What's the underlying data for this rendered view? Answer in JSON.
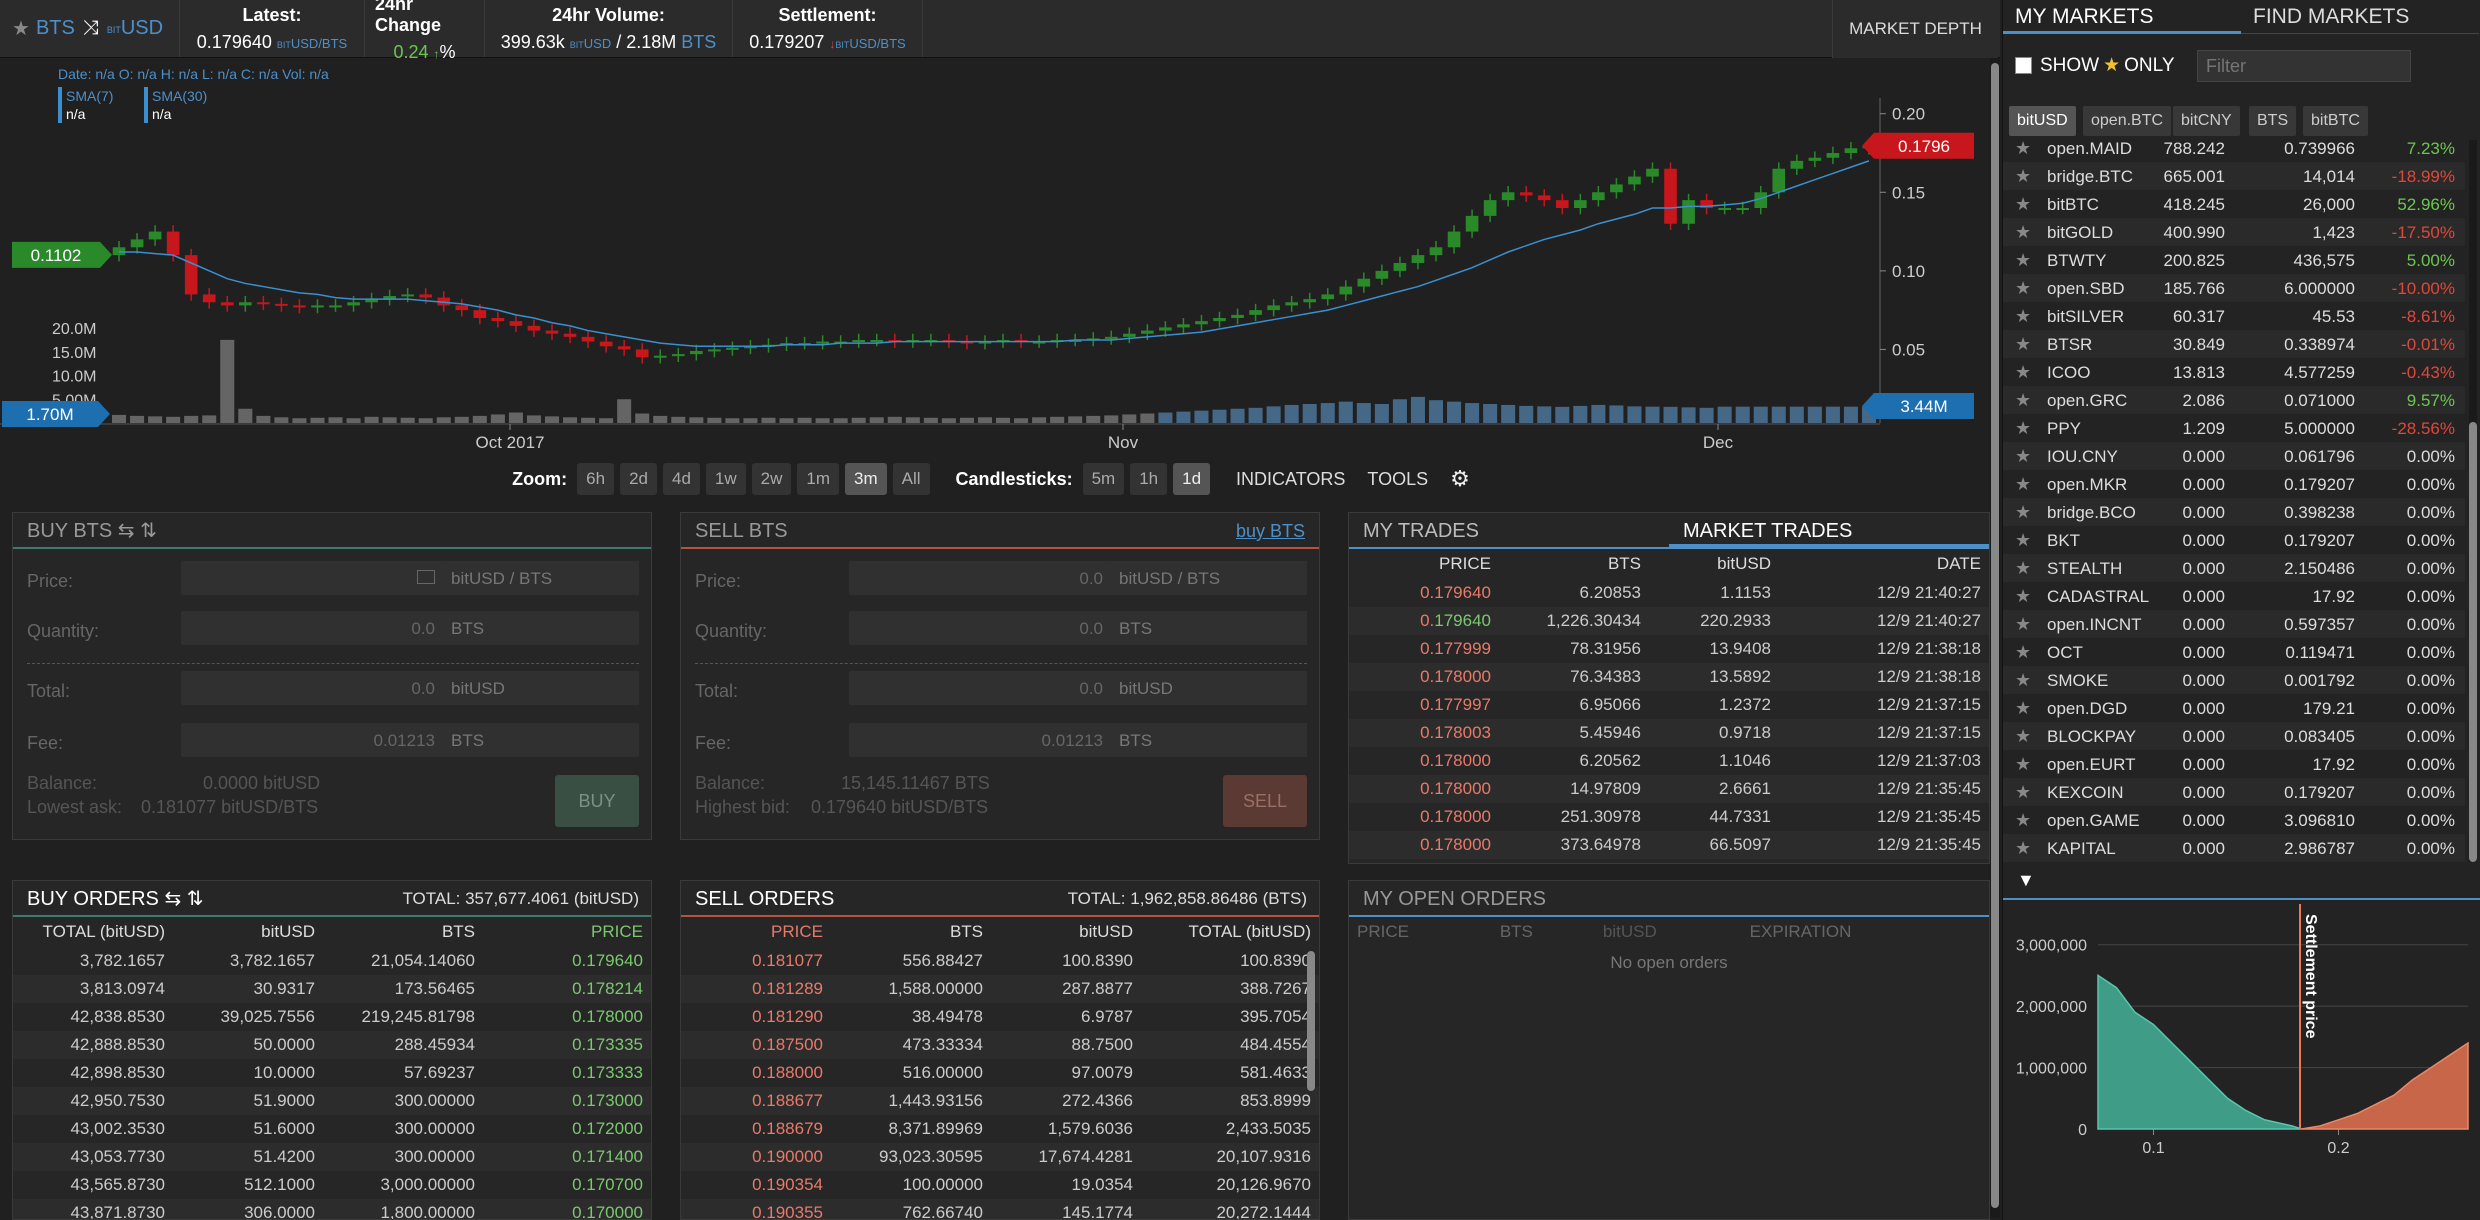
{
  "header": {
    "star": "★",
    "base": "BTS",
    "swap": "⤨",
    "quote_prefix": "bit",
    "quote": "USD",
    "latest_label": "Latest:",
    "latest_value": "0.179640",
    "latest_unit": "bitUSD/BTS",
    "change_label": "24hr Change",
    "change_value": "0.24",
    "change_arrow": "↑",
    "change_unit": "%",
    "volume_label": "24hr Volume:",
    "volume_quote": "399.63k",
    "volume_quote_unit": "bitUSD",
    "volume_base": "/ 2.18M",
    "volume_base_unit": "BTS",
    "settle_label": "Settlement:",
    "settle_value": "0.179207",
    "settle_arrow": "↓",
    "settle_unit": "bitUSD/BTS",
    "market_depth": "MARKET DEPTH"
  },
  "chart_info": {
    "legend": "Date: n/a O: n/a H: n/a L: n/a C: n/a Vol: n/a",
    "sma7_label": "SMA(7)",
    "sma7_val": "n/a",
    "sma30_label": "SMA(30)",
    "sma30_val": "n/a",
    "left_price_badge": "0.1102",
    "right_price_badge": "0.1796",
    "left_vol_badge": "1.70M",
    "right_vol_badge": "3.44M",
    "price_ticks": [
      "0.20",
      "0.15",
      "0.10",
      "0.05"
    ],
    "vol_ticks": [
      "20.0M",
      "15.0M",
      "10.0M",
      "5.00M"
    ],
    "date_ticks": [
      "Oct 2017",
      "Nov",
      "Dec"
    ]
  },
  "chart_data": {
    "type": "candlestick",
    "ylim": [
      0,
      0.21
    ],
    "close": [
      0.115,
      0.12,
      0.125,
      0.11,
      0.085,
      0.08,
      0.078,
      0.08,
      0.079,
      0.078,
      0.077,
      0.078,
      0.078,
      0.08,
      0.082,
      0.084,
      0.085,
      0.083,
      0.078,
      0.075,
      0.07,
      0.068,
      0.065,
      0.062,
      0.06,
      0.058,
      0.055,
      0.052,
      0.05,
      0.045,
      0.046,
      0.047,
      0.049,
      0.05,
      0.051,
      0.052,
      0.053,
      0.054,
      0.054,
      0.055,
      0.055,
      0.056,
      0.056,
      0.055,
      0.056,
      0.056,
      0.055,
      0.054,
      0.055,
      0.056,
      0.055,
      0.055,
      0.056,
      0.056,
      0.057,
      0.058,
      0.06,
      0.062,
      0.064,
      0.066,
      0.068,
      0.07,
      0.072,
      0.075,
      0.078,
      0.08,
      0.082,
      0.085,
      0.09,
      0.095,
      0.1,
      0.105,
      0.11,
      0.115,
      0.125,
      0.135,
      0.145,
      0.15,
      0.148,
      0.145,
      0.14,
      0.145,
      0.15,
      0.155,
      0.16,
      0.165,
      0.13,
      0.145,
      0.14,
      0.14,
      0.14,
      0.15,
      0.165,
      0.17,
      0.172,
      0.175,
      0.178,
      0.18
    ],
    "volume": [
      1.7,
      1.5,
      1.4,
      1.3,
      1.5,
      1.6,
      17.5,
      3.0,
      1.5,
      1.2,
      1.0,
      1.1,
      1.2,
      1.0,
      1.3,
      1.2,
      1.1,
      1.0,
      1.2,
      1.3,
      1.5,
      1.8,
      2.2,
      1.6,
      1.4,
      1.2,
      1.1,
      1.0,
      5.0,
      2.0,
      1.5,
      1.3,
      1.2,
      1.1,
      1.0,
      1.0,
      1.1,
      1.0,
      1.1,
      1.0,
      1.0,
      1.1,
      1.2,
      1.3,
      1.2,
      1.1,
      1.0,
      1.1,
      1.2,
      1.1,
      1.0,
      1.2,
      1.3,
      1.4,
      1.5,
      1.6,
      1.8,
      2.0,
      2.2,
      2.4,
      2.6,
      2.8,
      3.0,
      3.2,
      3.5,
      3.8,
      4.0,
      4.2,
      4.5,
      4.2,
      4.0,
      5.0,
      5.5,
      4.8,
      4.5,
      4.2,
      4.0,
      3.8,
      3.6,
      3.5,
      3.4,
      3.6,
      3.8,
      3.7,
      3.5,
      3.44,
      3.4,
      3.3,
      3.2,
      3.44,
      3.44,
      3.44,
      3.44,
      3.44,
      3.44,
      3.44,
      3.44,
      3.44
    ],
    "sma": [
      0.112,
      0.112,
      0.111,
      0.11,
      0.105,
      0.1,
      0.095,
      0.092,
      0.09,
      0.088,
      0.086,
      0.085,
      0.083,
      0.082,
      0.082,
      0.082,
      0.082,
      0.081,
      0.08,
      0.079,
      0.077,
      0.075,
      0.072,
      0.07,
      0.067,
      0.065,
      0.062,
      0.06,
      0.058,
      0.056,
      0.054,
      0.053,
      0.052,
      0.052,
      0.052,
      0.052,
      0.052,
      0.053,
      0.053,
      0.053,
      0.054,
      0.054,
      0.054,
      0.055,
      0.055,
      0.055,
      0.055,
      0.055,
      0.055,
      0.055,
      0.055,
      0.055,
      0.055,
      0.056,
      0.056,
      0.056,
      0.057,
      0.058,
      0.059,
      0.06,
      0.061,
      0.063,
      0.065,
      0.067,
      0.069,
      0.071,
      0.073,
      0.075,
      0.078,
      0.081,
      0.084,
      0.087,
      0.09,
      0.094,
      0.098,
      0.102,
      0.107,
      0.112,
      0.116,
      0.12,
      0.123,
      0.126,
      0.13,
      0.133,
      0.136,
      0.14,
      0.14,
      0.141,
      0.141,
      0.142,
      0.143,
      0.146,
      0.15,
      0.154,
      0.158,
      0.162,
      0.166,
      0.17
    ]
  },
  "zoom": {
    "label": "Zoom:",
    "options": [
      "6h",
      "2d",
      "4d",
      "1w",
      "2w",
      "1m",
      "3m",
      "All"
    ],
    "candle_label": "Candlesticks:",
    "candle_options": [
      "5m",
      "1h",
      "1d"
    ],
    "indicators": "INDICATORS",
    "tools": "TOOLS",
    "gear": "⚙"
  },
  "buy_form": {
    "title": "BUY BTS ⇆ ⇅",
    "price_label": "Price:",
    "price_unit": "bitUSD / BTS",
    "qty_label": "Quantity:",
    "qty_value": "0.0",
    "qty_unit": "BTS",
    "total_label": "Total:",
    "total_value": "0.0",
    "total_unit": "bitUSD",
    "fee_label": "Fee:",
    "fee_value": "0.01213",
    "fee_unit": "BTS",
    "balance_label": "Balance:",
    "balance_value": "0.0000 bitUSD",
    "ask_label": "Lowest ask:",
    "ask_value": "0.181077 bitUSD/BTS",
    "button": "BUY"
  },
  "sell_form": {
    "title": "SELL BTS",
    "link": "buy BTS",
    "price_label": "Price:",
    "price_value": "0.0",
    "price_unit": "bitUSD / BTS",
    "qty_label": "Quantity:",
    "qty_value": "0.0",
    "qty_unit": "BTS",
    "total_label": "Total:",
    "total_value": "0.0",
    "total_unit": "bitUSD",
    "fee_label": "Fee:",
    "fee_value": "0.01213",
    "fee_unit": "BTS",
    "balance_label": "Balance:",
    "balance_value": "15,145.11467 BTS",
    "bid_label": "Highest bid:",
    "bid_value": "0.179640 bitUSD/BTS",
    "button": "SELL"
  },
  "trades": {
    "tab_mine": "MY TRADES",
    "tab_market": "MARKET TRADES",
    "headers": [
      "PRICE",
      "BTS",
      "bitUSD",
      "DATE"
    ],
    "rows": [
      [
        "0.",
        "179640",
        "6.20853",
        "1.1153",
        "12/9 21:40:27",
        "red"
      ],
      [
        "0.",
        "179640",
        "1,226.30434",
        "220.2933",
        "12/9 21:40:27",
        "green"
      ],
      [
        "0.",
        "177999",
        "78.31956",
        "13.9408",
        "12/9 21:38:18",
        "red"
      ],
      [
        "0.",
        "178000",
        "76.34383",
        "13.5892",
        "12/9 21:38:18",
        "red"
      ],
      [
        "0.",
        "177997",
        "6.95066",
        "1.2372",
        "12/9 21:37:15",
        "red"
      ],
      [
        "0.",
        "178003",
        "5.45946",
        "0.9718",
        "12/9 21:37:15",
        "red"
      ],
      [
        "0.",
        "178000",
        "6.20562",
        "1.1046",
        "12/9 21:37:03",
        "red"
      ],
      [
        "0.",
        "178000",
        "14.97809",
        "2.6661",
        "12/9 21:35:45",
        "red"
      ],
      [
        "0.",
        "178000",
        "251.30978",
        "44.7331",
        "12/9 21:35:45",
        "red"
      ],
      [
        "0.",
        "178000",
        "373.64978",
        "66.5097",
        "12/9 21:35:45",
        "red"
      ]
    ]
  },
  "buy_orders": {
    "title": "BUY ORDERS ⇆ ⇅",
    "total": "TOTAL: 357,677.4061 (bitUSD)",
    "headers": [
      "TOTAL (bitUSD)",
      "bitUSD",
      "BTS",
      "PRICE"
    ],
    "rows": [
      [
        "3,782.1657",
        "3,782.1657",
        "21,054.14060",
        "0.",
        "179640"
      ],
      [
        "3,813.0974",
        "30.9317",
        "173.56465",
        "0.",
        "178214"
      ],
      [
        "42,838.8530",
        "39,025.7556",
        "219,245.81798",
        "0.",
        "178000"
      ],
      [
        "42,888.8530",
        "50.0000",
        "288.45934",
        "0.",
        "173335"
      ],
      [
        "42,898.8530",
        "10.0000",
        "57.69237",
        "0.",
        "173333"
      ],
      [
        "42,950.7530",
        "51.9000",
        "300.00000",
        "0.",
        "173000"
      ],
      [
        "43,002.3530",
        "51.6000",
        "300.00000",
        "0.",
        "172000"
      ],
      [
        "43,053.7730",
        "51.4200",
        "300.00000",
        "0.",
        "171400"
      ],
      [
        "43,565.8730",
        "512.1000",
        "3,000.00000",
        "0.",
        "170700"
      ],
      [
        "43,871.8730",
        "306.0000",
        "1,800.00000",
        "0.",
        "170000"
      ]
    ]
  },
  "sell_orders": {
    "title": "SELL ORDERS",
    "total": "TOTAL: 1,962,858.86486 (BTS)",
    "headers": [
      "PRICE",
      "BTS",
      "bitUSD",
      "TOTAL (bitUSD)"
    ],
    "rows": [
      [
        "0.",
        "181077",
        "556.88427",
        "100.8390",
        "100.8390"
      ],
      [
        "0.",
        "181289",
        "1,588.00000",
        "287.8877",
        "388.7267"
      ],
      [
        "0.",
        "181290",
        "38.49478",
        "6.9787",
        "395.7054"
      ],
      [
        "0.",
        "187500",
        "473.33334",
        "88.7500",
        "484.4554"
      ],
      [
        "0.",
        "188000",
        "516.00000",
        "97.0079",
        "581.4633"
      ],
      [
        "0.",
        "188677",
        "1,443.93156",
        "272.4366",
        "853.8999"
      ],
      [
        "0.",
        "188679",
        "8,371.89969",
        "1,579.6036",
        "2,433.5035"
      ],
      [
        "0.",
        "190000",
        "93,023.30595",
        "17,674.4281",
        "20,107.9316"
      ],
      [
        "0.",
        "190354",
        "100.00000",
        "19.0354",
        "20,126.9670"
      ],
      [
        "0.",
        "190355",
        "762.66740",
        "145.1774",
        "20,272.1444"
      ]
    ]
  },
  "open_orders": {
    "title": "MY OPEN ORDERS",
    "headers": [
      "PRICE",
      "BTS",
      "bitUSD",
      "EXPIRATION"
    ],
    "empty": "No open orders"
  },
  "sidebar": {
    "tab_my": "MY MARKETS",
    "tab_find": "FIND MARKETS",
    "show_label": "SHOW",
    "star": "★",
    "only_label": "ONLY",
    "filter_placeholder": "Filter",
    "quote_buttons": [
      "bitUSD",
      "open.BTC",
      "bitCNY",
      "BTS",
      "bitBTC"
    ],
    "markets": [
      [
        "open.MAID",
        "788.242",
        "0.739966",
        "7.23%",
        "green"
      ],
      [
        "bridge.BTC",
        "665.001",
        "14,014",
        "-18.99%",
        "red"
      ],
      [
        "bitBTC",
        "418.245",
        "26,000",
        "52.96%",
        "green"
      ],
      [
        "bitGOLD",
        "400.990",
        "1,423",
        "-17.50%",
        "red"
      ],
      [
        "BTWTY",
        "200.825",
        "436,575",
        "5.00%",
        "green"
      ],
      [
        "open.SBD",
        "185.766",
        "6.000000",
        "-10.00%",
        "red"
      ],
      [
        "bitSILVER",
        "60.317",
        "45.53",
        "-8.61%",
        "red"
      ],
      [
        "BTSR",
        "30.849",
        "0.338974",
        "-0.01%",
        "red"
      ],
      [
        "ICOO",
        "13.813",
        "4.577259",
        "-0.43%",
        "red"
      ],
      [
        "open.GRC",
        "2.086",
        "0.071000",
        "9.57%",
        "green"
      ],
      [
        "PPY",
        "1.209",
        "5.000000",
        "-28.56%",
        "red"
      ],
      [
        "IOU.CNY",
        "0.000",
        "0.061796",
        "0.00%",
        "white"
      ],
      [
        "open.MKR",
        "0.000",
        "0.179207",
        "0.00%",
        "white"
      ],
      [
        "bridge.BCO",
        "0.000",
        "0.398238",
        "0.00%",
        "white"
      ],
      [
        "BKT",
        "0.000",
        "0.179207",
        "0.00%",
        "white"
      ],
      [
        "STEALTH",
        "0.000",
        "2.150486",
        "0.00%",
        "white"
      ],
      [
        "CADASTRAL",
        "0.000",
        "17.92",
        "0.00%",
        "white"
      ],
      [
        "open.INCNT",
        "0.000",
        "0.597357",
        "0.00%",
        "white"
      ],
      [
        "OCT",
        "0.000",
        "0.119471",
        "0.00%",
        "white"
      ],
      [
        "SMOKE",
        "0.000",
        "0.001792",
        "0.00%",
        "white"
      ],
      [
        "open.DGD",
        "0.000",
        "179.21",
        "0.00%",
        "white"
      ],
      [
        "BLOCKPAY",
        "0.000",
        "0.083405",
        "0.00%",
        "white"
      ],
      [
        "open.EURT",
        "0.000",
        "17.92",
        "0.00%",
        "white"
      ],
      [
        "KEXCOIN",
        "0.000",
        "0.179207",
        "0.00%",
        "white"
      ],
      [
        "open.GAME",
        "0.000",
        "3.096810",
        "0.00%",
        "white"
      ],
      [
        "KAPITAL",
        "0.000",
        "2.986787",
        "0.00%",
        "white"
      ]
    ],
    "collapse": "▼",
    "depth_yticks": [
      "3,000,000",
      "2,000,000",
      "1,000,000",
      "0"
    ],
    "depth_xticks": [
      "0.1",
      "0.2"
    ],
    "settlement_label": "Settlement price"
  },
  "colors": {
    "up": "#2a8a2a",
    "down": "#c8161d",
    "sma": "#3a8fd0",
    "volume": "#777777",
    "bid_depth": "#3f9c87",
    "ask_depth": "#c8664a"
  }
}
